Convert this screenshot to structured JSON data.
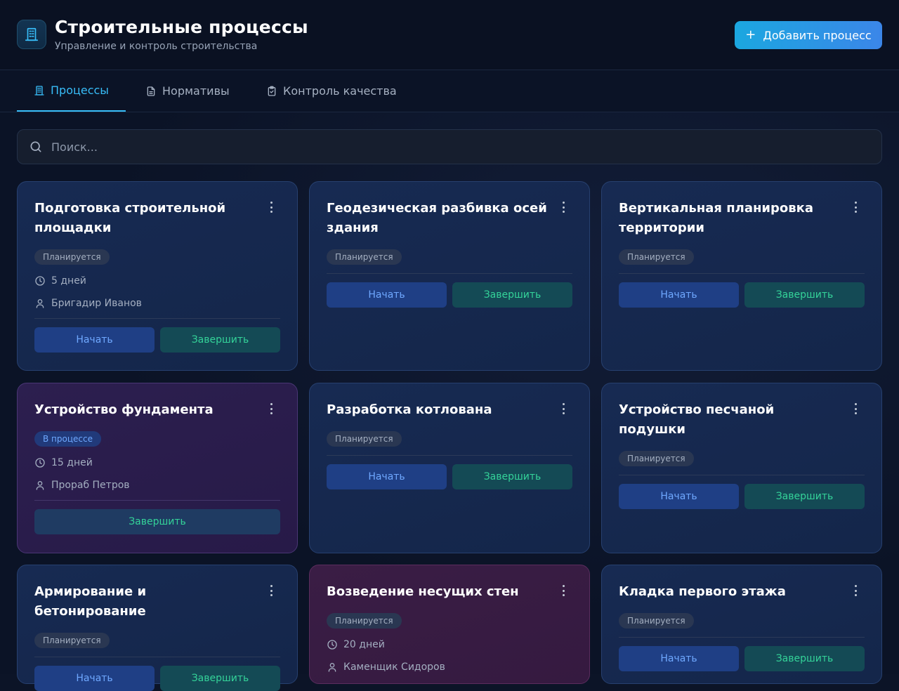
{
  "header": {
    "title": "Строительные процессы",
    "subtitle": "Управление и контроль строительства",
    "add_button": "Добавить процесс",
    "add_icon": "+"
  },
  "tabs": [
    {
      "label": "Процессы",
      "icon": "building-icon",
      "active": true
    },
    {
      "label": "Нормативы",
      "icon": "document-icon",
      "active": false
    },
    {
      "label": "Контроль качества",
      "icon": "clipboard-check-icon",
      "active": false
    }
  ],
  "search": {
    "placeholder": "Поиск...",
    "value": ""
  },
  "actions": {
    "start": "Начать",
    "finish": "Завершить"
  },
  "cards": [
    {
      "title": "Подготовка строительной площадки",
      "status": "Планируется",
      "duration": "5 дней",
      "assignee": "Бригадир Иванов"
    },
    {
      "title": "Геодезическая разбивка осей здания",
      "status": "Планируется"
    },
    {
      "title": "Вертикальная планировка территории",
      "status": "Планируется"
    },
    {
      "title": "Устройство фундамента",
      "status": "В процессе",
      "duration": "15 дней",
      "assignee": "Прораб Петров"
    },
    {
      "title": "Разработка котлована",
      "status": "Планируется"
    },
    {
      "title": "Устройство песчаной подушки",
      "status": "Планируется"
    },
    {
      "title": "Армирование и бетонирование",
      "status": "Планируется"
    },
    {
      "title": "Возведение несущих стен",
      "status": "Планируется",
      "duration": "20 дней",
      "assignee": "Каменщик Сидоров"
    },
    {
      "title": "Кладка первого этажа",
      "status": "Планируется"
    }
  ],
  "colors": {
    "accent": "#38bdf8",
    "start": "#6fa8ff",
    "finish": "#34d399",
    "card_bg": "#172a52"
  }
}
